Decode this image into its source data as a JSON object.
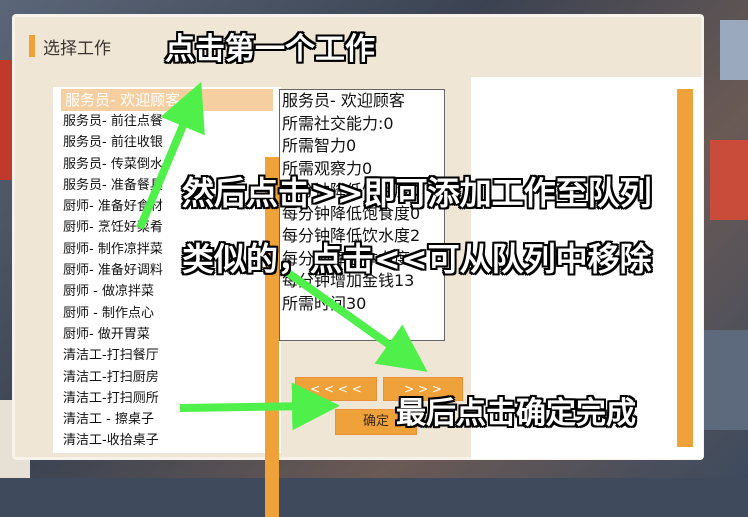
{
  "dialog": {
    "title": "选择工作"
  },
  "job_list": {
    "selected": "服务员- 欢迎顾客",
    "items": [
      "服务员- 前往点餐",
      "服务员- 前往收银",
      "服务员- 传菜倒水",
      "服务员- 准备餐具",
      "厨师- 准备好食材",
      "厨师- 烹饪好菜肴",
      "厨师- 制作凉拌菜",
      "厨师- 准备好调料",
      "厨师 - 做凉拌菜",
      "厨师 - 制作点心",
      "厨师- 做开胃菜",
      "清洁工-打扫餐厅",
      "清洁工-打扫厨房",
      "清洁工-打扫厕所",
      "清洁工 - 擦桌子",
      "清洁工-收拾桌子"
    ]
  },
  "job_detail": {
    "lines": [
      "服务员- 欢迎顾客",
      "所需社交能力:0",
      "所需智力0",
      "所需观察力0",
      "每分钟降低饥饿度0",
      "每分钟降低饱食度0",
      "每分钟降低饮水度2",
      "每分钟降低体力度2",
      "每分钟增加金钱13",
      "所需时间30"
    ]
  },
  "buttons": {
    "remove": "< < < <",
    "add": "> > >",
    "confirm": "确定"
  },
  "instructions": {
    "step1": "点击第一个工作",
    "step2": "然后点击>>即可添加工作至队列",
    "step3": "类似的，点击<<可从队列中移除",
    "step4": "最后点击确定完成"
  },
  "colors": {
    "accent": "#f0a23a",
    "panel_bg": "#efe6d6",
    "arrow": "#4ff04a"
  }
}
